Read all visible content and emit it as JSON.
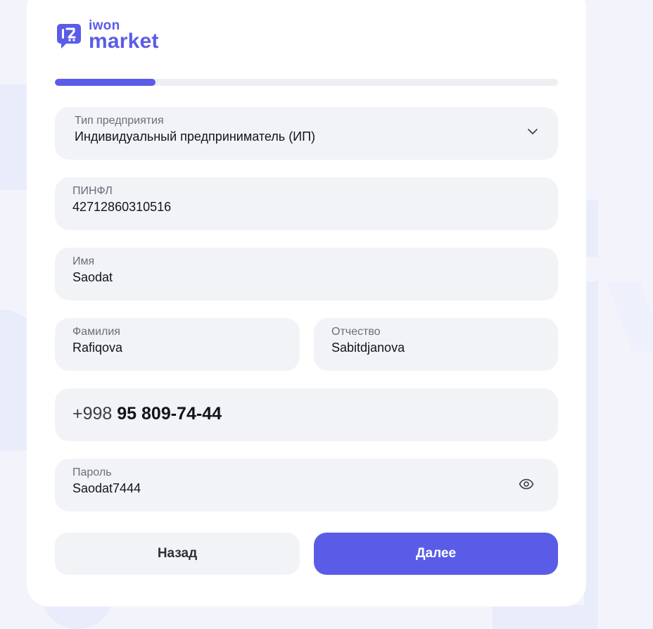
{
  "brand": {
    "line1": "iwon",
    "line2": "market",
    "color": "#5a5ce8"
  },
  "progress": {
    "value": 0.2
  },
  "form": {
    "business_type": {
      "label": "Тип предприятия",
      "value": "Индивидуальный предприниматель (ИП)",
      "icon": "chevron-down-icon"
    },
    "pinfl": {
      "label": "ПИНФЛ",
      "value": "42712860310516"
    },
    "first_name": {
      "label": "Имя",
      "value": "Saodat"
    },
    "last_name": {
      "label": "Фамилия",
      "value": "Rafiqova"
    },
    "middle_name": {
      "label": "Отчество",
      "value": "Sabitdjanova"
    },
    "phone": {
      "country_code": "+998",
      "number": "95 809-74-44"
    },
    "password": {
      "label": "Пароль",
      "value": "Saodat7444",
      "icon": "eye-icon"
    }
  },
  "buttons": {
    "back": "Назад",
    "next": "Далее"
  },
  "colors": {
    "accent": "#5a5ce8",
    "field_bg": "#f2f3f7",
    "page_bg": "#f3f4fb"
  }
}
